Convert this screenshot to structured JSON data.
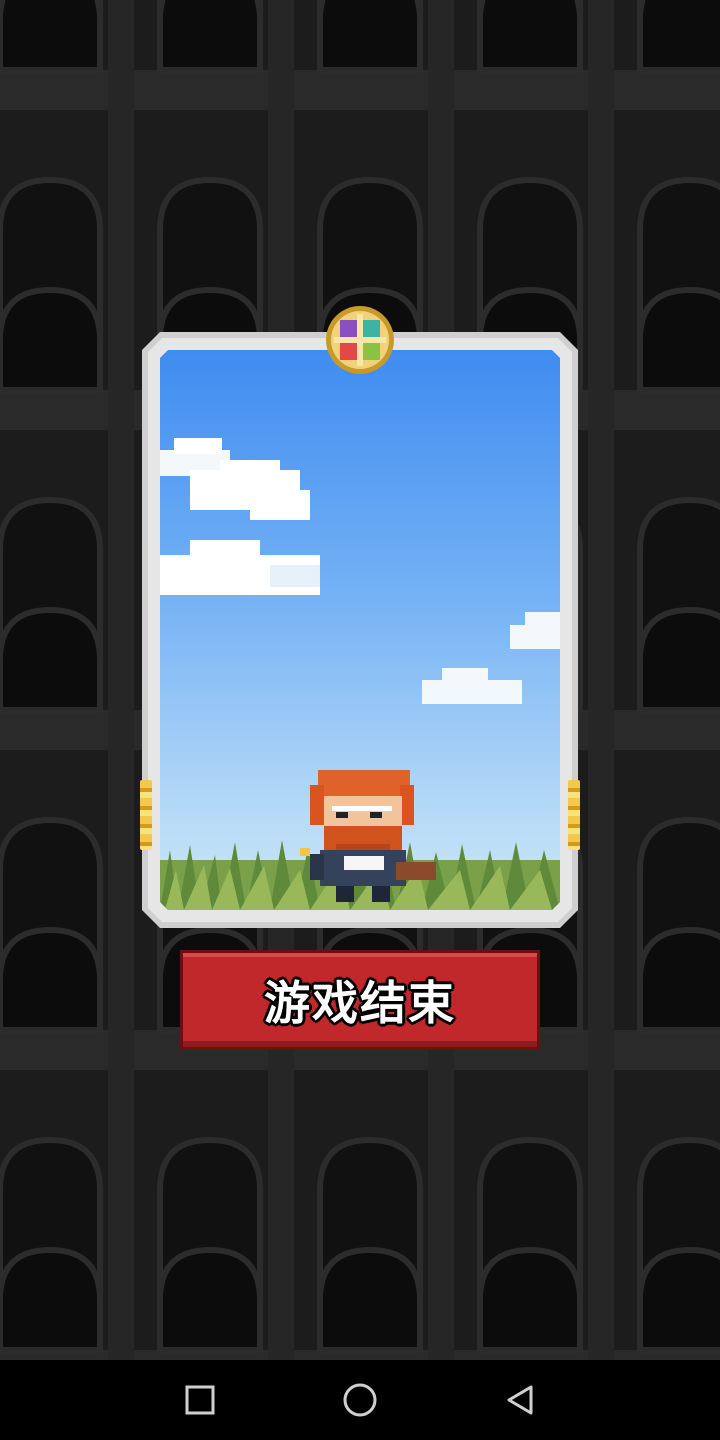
{
  "game": {
    "game_over_label": "游戏结束"
  },
  "icons": {
    "medallion": "four-color-cross-medallion-icon",
    "nav_recents": "square-icon",
    "nav_home": "circle-icon",
    "nav_back": "triangle-back-icon"
  },
  "colors": {
    "button_red": "#c0282b",
    "sky_top": "#3f8cf0",
    "card_frame": "#e6e6e6",
    "background": "#1a1a1a"
  }
}
